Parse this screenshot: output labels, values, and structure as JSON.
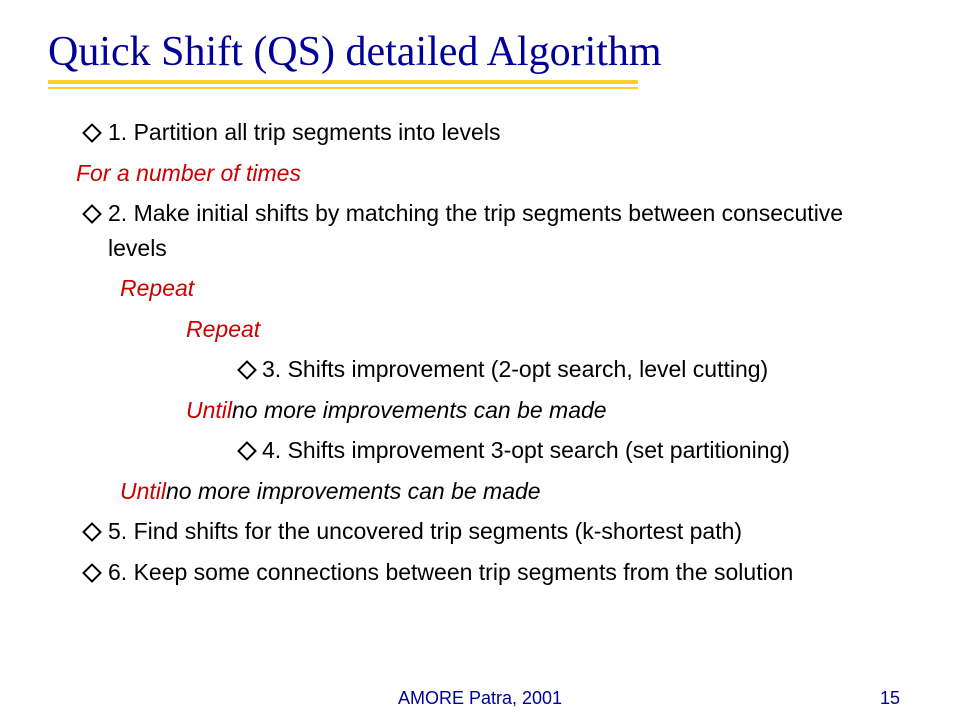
{
  "title": "Quick Shift (QS) detailed Algorithm",
  "body": {
    "item1": "1. Partition all trip segments into levels",
    "for_line": "For a number of times",
    "item2": "2. Make initial shifts by matching the trip segments between consecutive levels",
    "repeat1": "Repeat",
    "repeat2": "Repeat",
    "item3": "3. Shifts improvement (2-opt search, level cutting)",
    "until1_prefix": "Until",
    "until1_rest": " no more improvements can be made",
    "item4": "4. Shifts improvement 3-opt search (set partitioning)",
    "until2_prefix": "Until",
    "until2_rest": " no more improvements can be made",
    "item5": "5. Find shifts for the uncovered trip segments (k-shortest path)",
    "item6": "6. Keep some connections between trip segments from the solution"
  },
  "footer": {
    "center": "AMORE Patra,  2001",
    "page": "15"
  }
}
